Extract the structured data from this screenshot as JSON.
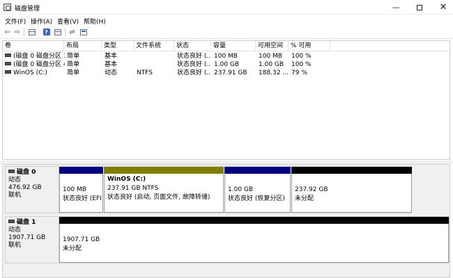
{
  "window": {
    "title": "磁盘管理"
  },
  "controls": {
    "minimize": "—",
    "close": "✕"
  },
  "menu": [
    {
      "label": "文件(F)"
    },
    {
      "label": "操作(A)"
    },
    {
      "label": "查看(V)"
    },
    {
      "label": "帮助(H)"
    }
  ],
  "toolbar": {
    "icons": [
      "back-arrow-icon",
      "forward-arrow-icon",
      "properties-icon",
      "help-icon",
      "console-icon",
      "connect-icon",
      "window-icon"
    ],
    "back": "⇦",
    "forward": "⇨",
    "help": "?",
    "connect": "⇌"
  },
  "volume_list": {
    "columns": [
      "卷",
      "布局",
      "类型",
      "文件系统",
      "状态",
      "容量",
      "可用空间",
      "% 可用"
    ],
    "rows": [
      [
        "(磁盘 0 磁盘分区 1)",
        "简单",
        "基本",
        "",
        "状态良好 (...",
        "100 MB",
        "100 MB",
        "100 %"
      ],
      [
        "(磁盘 0 磁盘分区 4)",
        "简单",
        "基本",
        "",
        "状态良好 (...",
        "1.00 GB",
        "1.00 GB",
        "100 %"
      ],
      [
        "WinOS (C:)",
        "简单",
        "动态",
        "NTFS",
        "状态良好 (...",
        "237.91 GB",
        "188.32 ...",
        "79 %"
      ]
    ]
  },
  "disks": [
    {
      "name": "磁盘 0",
      "type": "动态",
      "size": "476.92 GB",
      "status": "联机",
      "partitions": [
        {
          "name": "",
          "size": "100 MB",
          "status": "状态良好 (EFI 系",
          "bar_color": "#000080"
        },
        {
          "name": "WinOS  (C:)",
          "size": "237.91 GB NTFS",
          "status": "状态良好 (启动, 页面文件, 故障转储)",
          "bar_color": "#808000"
        },
        {
          "name": "",
          "size": "1.00 GB",
          "status": "状态良好 (恢复分区)",
          "bar_color": "#000080"
        },
        {
          "name": "",
          "size": "237.92 GB",
          "status": "未分配",
          "bar_color": "#000000"
        }
      ]
    },
    {
      "name": "磁盘 1",
      "type": "动态",
      "size": "1907.71 GB",
      "status": "联机",
      "partitions": [
        {
          "name": "",
          "size": "1907.71 GB",
          "status": "未分配",
          "bar_color": "#000000"
        }
      ]
    }
  ]
}
